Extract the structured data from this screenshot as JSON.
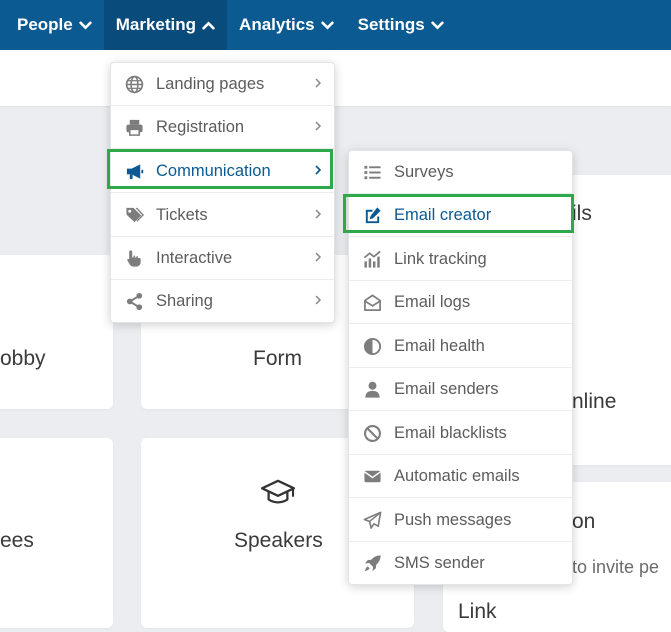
{
  "nav": {
    "items": [
      {
        "label": "People"
      },
      {
        "label": "Marketing"
      },
      {
        "label": "Analytics"
      },
      {
        "label": "Settings"
      }
    ]
  },
  "background": {
    "cards": [
      {
        "label": "obby"
      },
      {
        "label": "Form"
      },
      {
        "label": "ils"
      },
      {
        "label": "nline"
      },
      {
        "label": "ees"
      },
      {
        "label": "Speakers"
      },
      {
        "label": "on"
      },
      {
        "sub": "to invite pe"
      },
      {
        "sub": "Link"
      }
    ]
  },
  "marketing_menu": {
    "items": [
      {
        "label": "Landing pages",
        "icon": "globe-icon"
      },
      {
        "label": "Registration",
        "icon": "printer-icon"
      },
      {
        "label": "Communication",
        "icon": "megaphone-icon"
      },
      {
        "label": "Tickets",
        "icon": "tags-icon"
      },
      {
        "label": "Interactive",
        "icon": "hand-pointer-icon"
      },
      {
        "label": "Sharing",
        "icon": "share-icon"
      }
    ]
  },
  "communication_menu": {
    "items": [
      {
        "label": "Surveys",
        "icon": "list-icon"
      },
      {
        "label": "Email creator",
        "icon": "edit-icon"
      },
      {
        "label": "Link tracking",
        "icon": "chart-icon"
      },
      {
        "label": "Email logs",
        "icon": "envelope-open-icon"
      },
      {
        "label": "Email health",
        "icon": "half-circle-icon"
      },
      {
        "label": "Email senders",
        "icon": "user-icon"
      },
      {
        "label": "Email blacklists",
        "icon": "ban-icon"
      },
      {
        "label": "Automatic emails",
        "icon": "envelope-icon"
      },
      {
        "label": "Push messages",
        "icon": "paper-plane-icon"
      },
      {
        "label": "SMS sender",
        "icon": "rocket-icon"
      }
    ]
  },
  "colors": {
    "nav_bg": "#0b5a91",
    "active_text": "#0b5a91",
    "highlight": "#2ea84a"
  }
}
